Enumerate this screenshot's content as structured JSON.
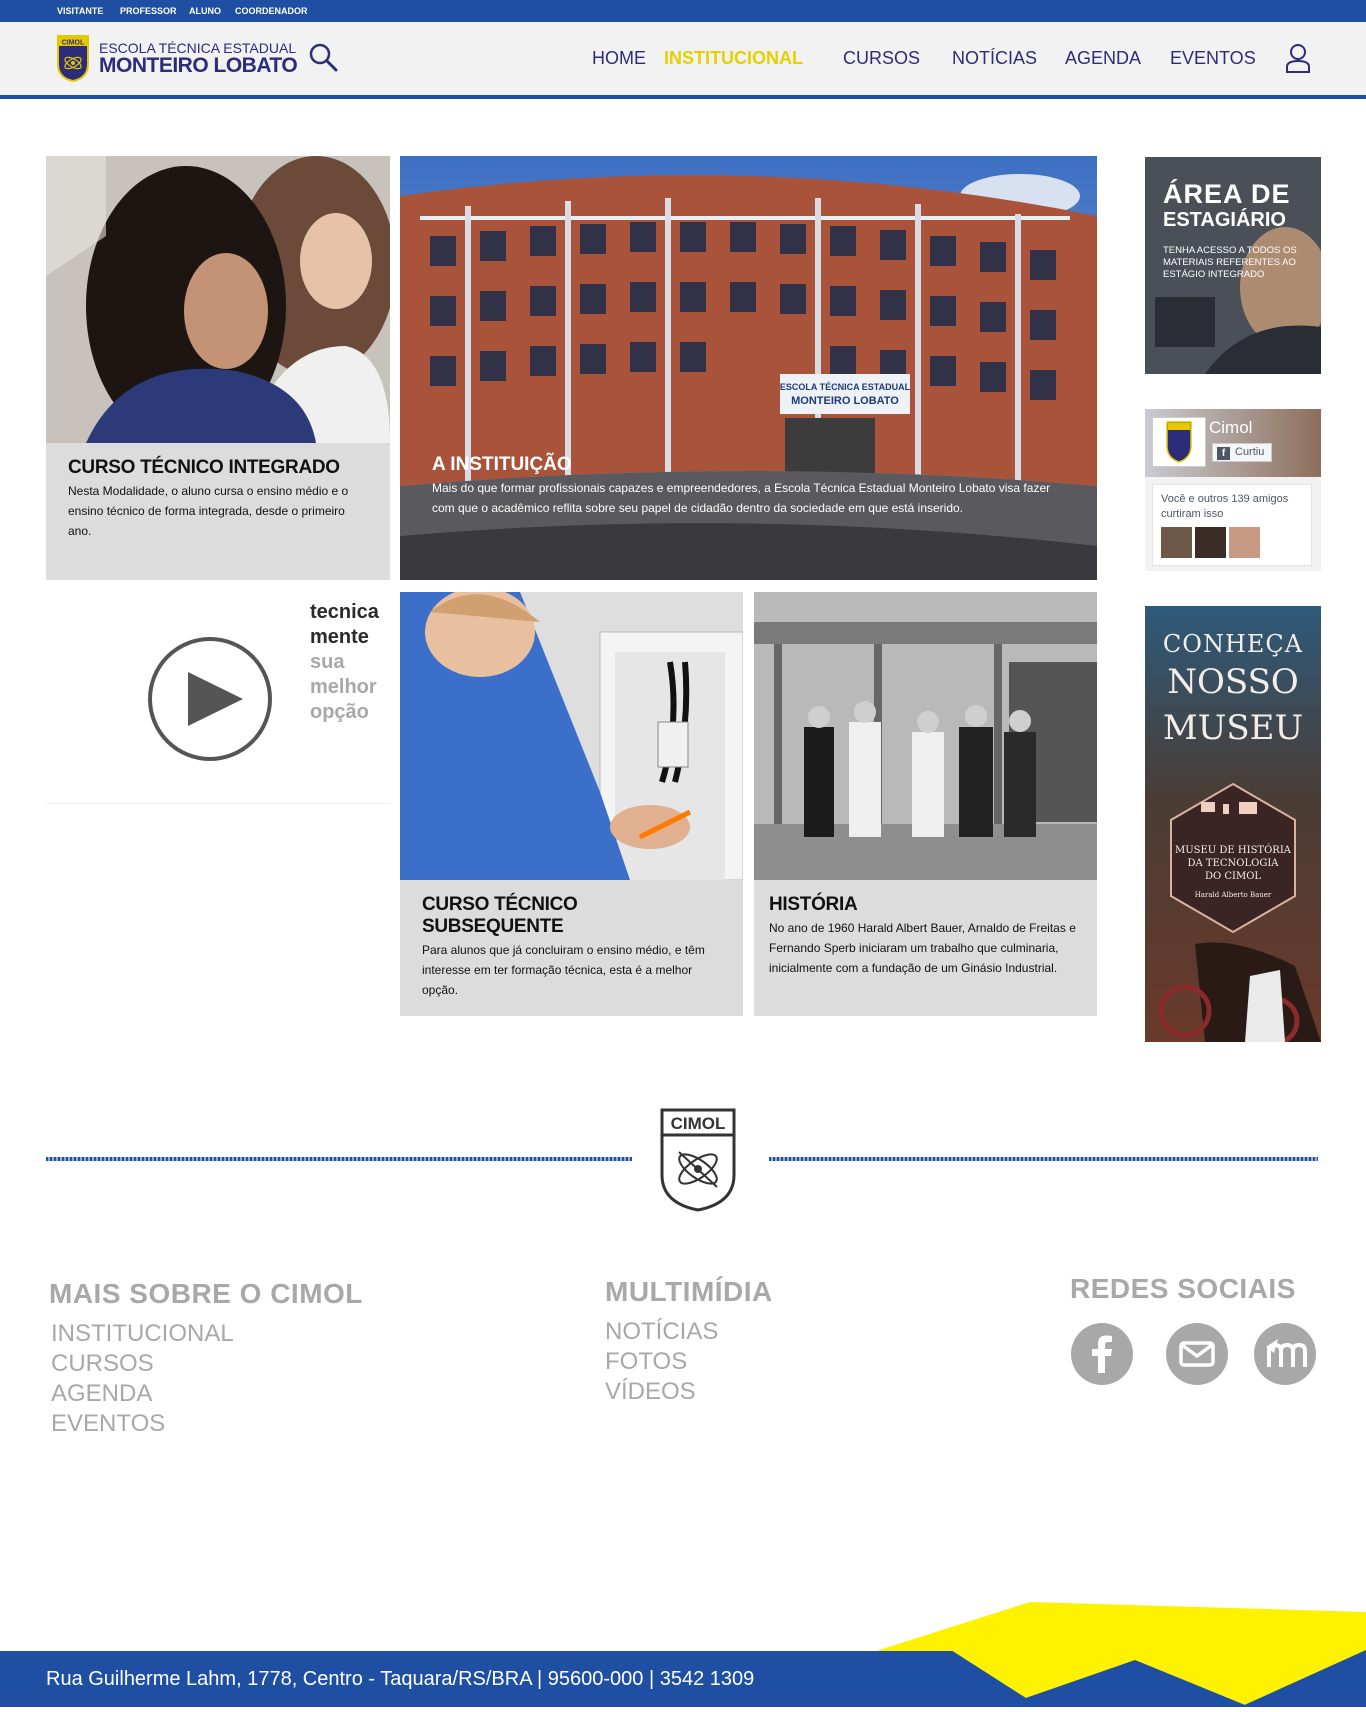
{
  "topbar": {
    "links": [
      "VISITANTE",
      "PROFESSOR",
      "ALUNO",
      "COORDENADOR"
    ]
  },
  "header": {
    "logo_badge": "CIMOL",
    "school_line1": "ESCOLA TÉCNICA ESTADUAL",
    "school_line2": "MONTEIRO LOBATO",
    "search_icon": "search-icon",
    "user_icon": "user-icon",
    "nav": [
      "HOME",
      "INSTITUCIONAL",
      "CURSOS",
      "NOTÍCIAS",
      "AGENDA",
      "EVENTOS"
    ],
    "active_nav": "INSTITUCIONAL"
  },
  "tiles": {
    "integrado": {
      "title": "CURSO TÉCNICO INTEGRADO",
      "text": "Nesta Modalidade, o aluno cursa o ensino médio e o ensino técnico de forma integrada, desde o primeiro ano."
    },
    "instituicao": {
      "title": "A INSTITUIÇÃO",
      "text": "Mais do que formar profissionais capazes e empreendedores, a Escola Técnica Estadual Monteiro Lobato visa fazer com que o acadêmico reflita sobre seu papel de cidadão dentro da sociedade em que está inserido.",
      "building_sign_1": "ESCOLA TÉCNICA ESTADUAL",
      "building_sign_2": "MONTEIRO LOBATO"
    },
    "video": {
      "line1": "tecnica",
      "line2": "mente",
      "line3": "sua",
      "line4": "melhor",
      "line5": "opção"
    },
    "subsequente": {
      "title": "CURSO TÉCNICO SUBSEQUENTE",
      "text": "Para alunos que já concluiram o ensino médio, e têm interesse em ter formação técnica, esta é a melhor opção."
    },
    "historia": {
      "title": "HISTÓRIA",
      "text": "No ano de 1960 Harald Albert Bauer, Arnaldo de Freitas e Fernando Sperb iniciaram um trabalho que culminaria, inicialmente com a fundação de um Ginásio Industrial."
    }
  },
  "sidebar": {
    "estagiario": {
      "title1": "ÁREA DE",
      "title2": "ESTAGIÁRIO",
      "text": "TENHA ACESSO A TODOS OS MATERIAIS REFERENTES AO ESTÁGIO INTEGRADO"
    },
    "facebook": {
      "page_name": "Cimol",
      "like_label": "Curtiu",
      "friends_text": "Você e outros 139 amigos curtiram isso"
    },
    "museu": {
      "line1": "CONHEÇA",
      "line2": "NOSSO",
      "line3": "MUSEU",
      "badge1": "MUSEU DE HISTÓRIA",
      "badge2": "DA TECNOLOGIA",
      "badge3": "DO CIMOL",
      "badge4": "Harald Alberto Bauer"
    }
  },
  "footer": {
    "emblem": "CIMOL",
    "col1_title": "MAIS SOBRE O CIMOL",
    "col1_links": [
      "INSTITUCIONAL",
      "CURSOS",
      "AGENDA",
      "EVENTOS"
    ],
    "col2_title": "MULTIMÍDIA",
    "col2_links": [
      "NOTÍCIAS",
      "FOTOS",
      "VÍDEOS"
    ],
    "col3_title": "REDES SOCIAIS",
    "social_icons": [
      "facebook-icon",
      "email-icon",
      "moodle-icon"
    ],
    "address": "Rua Guilherme Lahm, 1778, Centro - Taquara/RS/BRA | 95600-000 | 3542 1309"
  },
  "colors": {
    "brand_blue": "#1e4fa3",
    "nav_text": "#2c2c7a",
    "active_yellow": "#e6d000",
    "caption_gray": "#dcdcdc",
    "footer_gray": "#a8a8a8",
    "accent_yellow": "#ffee00"
  }
}
